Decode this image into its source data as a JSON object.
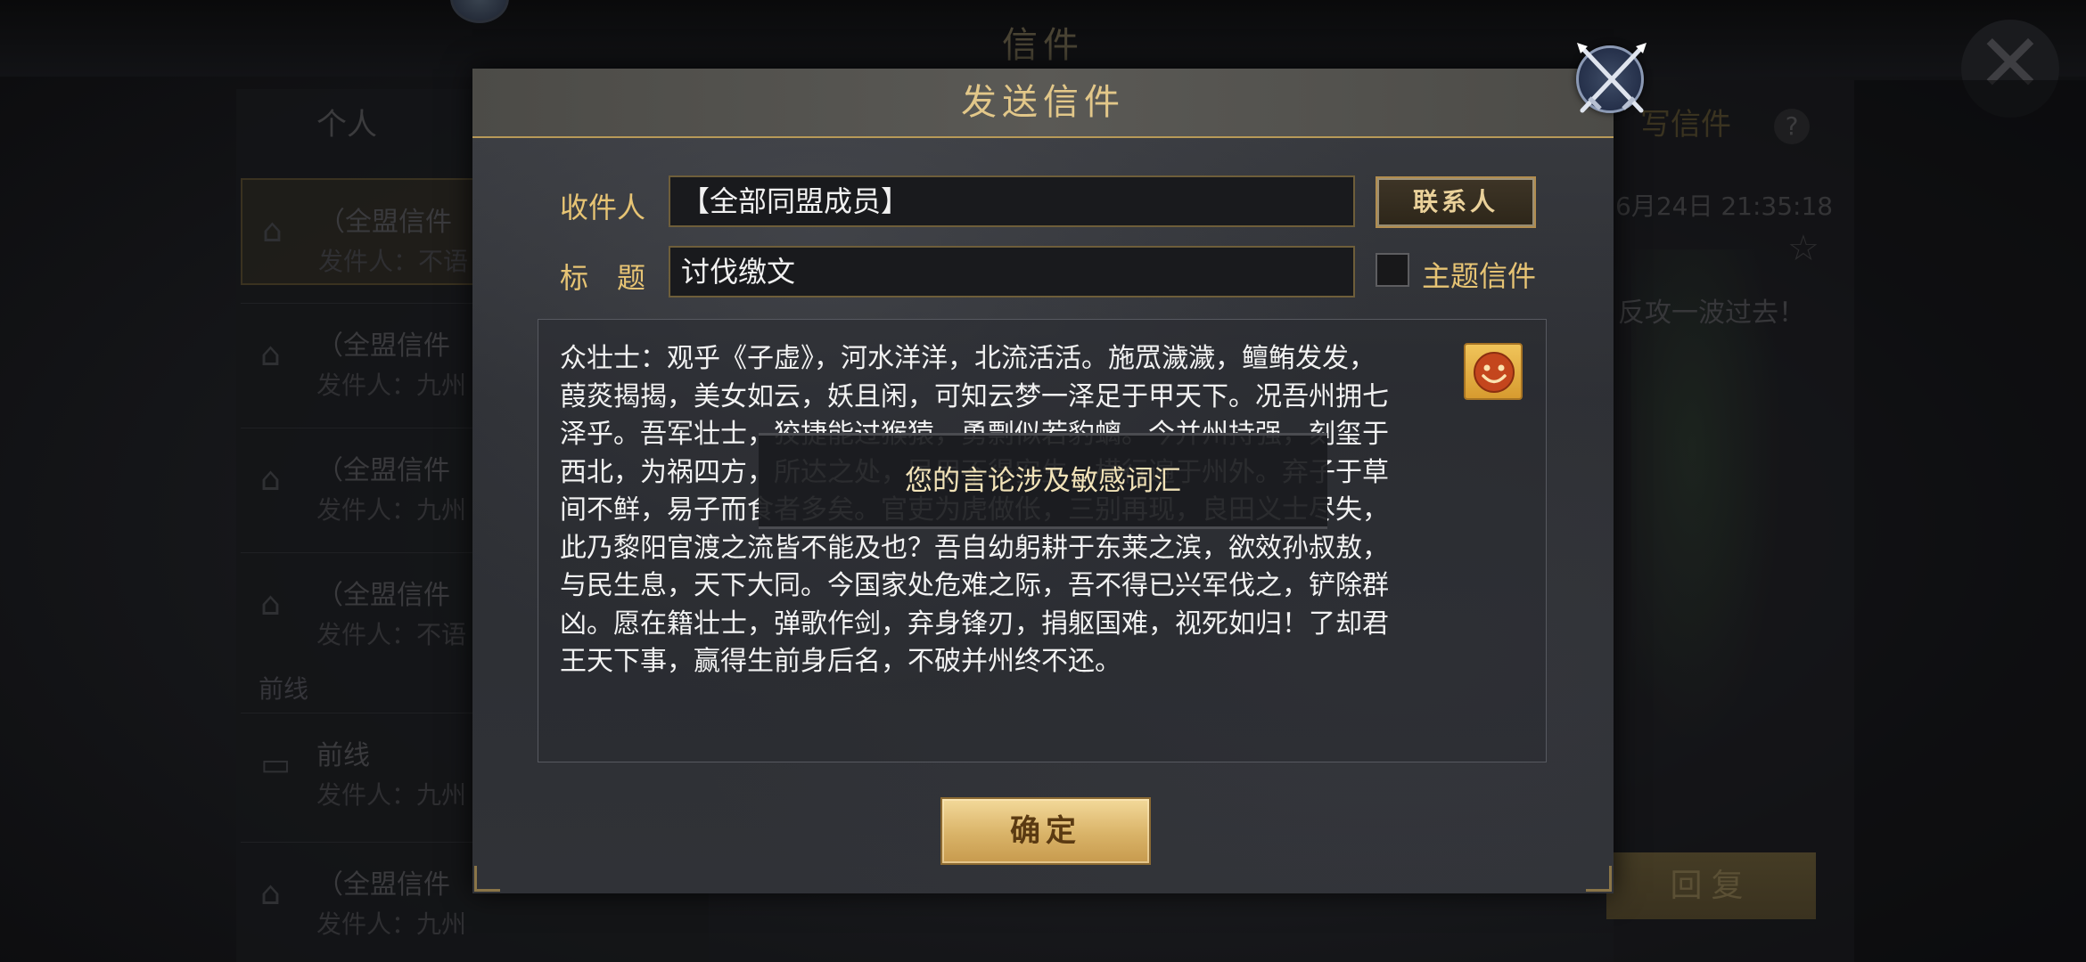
{
  "background": {
    "window_title": "信件",
    "tab_personal": "个人",
    "mail_items": [
      {
        "title": "（全盟信件",
        "sender": "发件人：不语"
      },
      {
        "title": "（全盟信件",
        "sender": "发件人：九州"
      },
      {
        "title": "（全盟信件",
        "sender": "发件人：九州"
      },
      {
        "title": "（全盟信件",
        "sender": "发件人：不语"
      }
    ],
    "section_frontline": "前线",
    "frontline_items": [
      {
        "title": "前线",
        "sender": "发件人：九州"
      },
      {
        "title": "（全盟信件",
        "sender": "发件人：九州"
      }
    ],
    "right_tab": "写信件",
    "help_label": "?",
    "date_text": "6月24日 21:35:18",
    "body_preview": "反攻一波过去！",
    "reply_button": "回复",
    "close_glyph": "✕"
  },
  "dialog": {
    "title": "发送信件",
    "recipient_label": "收件人",
    "recipient_value": "【全部同盟成员】",
    "contacts_button": "联系人",
    "subject_label": "标　题",
    "subject_value": "讨伐缴文",
    "theme_mail_label": "主题信件",
    "theme_mail_checked": false,
    "content_lines": [
      "众壮士：观乎《子虚》，河水洋洋，北流活活。施罛濊濊，鳣鲔发发，",
      "葭菼揭揭，美女如云，妖且闲，可知云梦一泽足于甲天下。况吾州拥七",
      "泽乎。吾军壮士，狡捷能过猴猿，勇剽似若豹螭。今并州持强，刻玺于",
      "西北，为祸四方，所达之处，民用不得安生，横行遍于州外。弃子于草",
      "间不鲜，易子而食者多矣。官吏为虎做伥，三别再现，良田义士尽失，",
      "此乃黎阳官渡之流皆不能及也？吾自幼躬耕于东莱之滨，欲效孙叔敖，",
      "与民生息，天下大同。今国家处危难之际，吾不得已兴军伐之，铲除群",
      "凶。愿在籍壮士，弹歌作剑，弃身锋刃，捐躯国难，视死如归！了却君",
      "王天下事，赢得生前身后名，不破并州终不还。"
    ],
    "toast": "您的言论涉及敏感词汇",
    "confirm_button": "确定"
  },
  "colors": {
    "accent_gold": "#e7c474",
    "title_gold": "#e2c789",
    "button_gold": "#d9b368"
  }
}
